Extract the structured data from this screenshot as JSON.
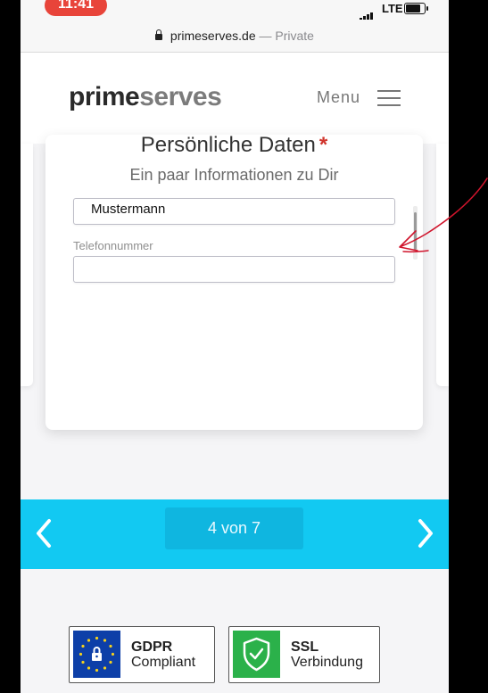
{
  "status": {
    "time": "11:41",
    "network": "LTE"
  },
  "browser": {
    "domain": "primeserves.de",
    "separator": "—",
    "mode": "Private"
  },
  "header": {
    "logo_part1": "prime",
    "logo_part2": "serves",
    "menu_label": "Menu"
  },
  "form": {
    "title": "Persönliche Daten",
    "required_marker": "*",
    "subtitle": "Ein paar Informationen zu Dir",
    "lastname_value": "Mustermann",
    "phone_label": "Telefonnummer",
    "phone_value": ""
  },
  "pager": {
    "label": "4 von 7",
    "current": 4,
    "total": 7
  },
  "trust": {
    "gdpr_line1": "GDPR",
    "gdpr_line2": "Compliant",
    "ssl_line1": "SSL",
    "ssl_line2": "Verbindung"
  },
  "colors": {
    "accent": "#12c9f2",
    "required": "#d0342c",
    "gdpr_blue": "#0d3fa8",
    "ssl_green": "#2bb14a",
    "annotation": "#d0142c"
  },
  "icons": [
    "lock-icon",
    "signal-icon",
    "battery-icon",
    "menu-icon",
    "chevron-left-icon",
    "chevron-right-icon",
    "eu-stars-icon",
    "shield-check-icon"
  ]
}
